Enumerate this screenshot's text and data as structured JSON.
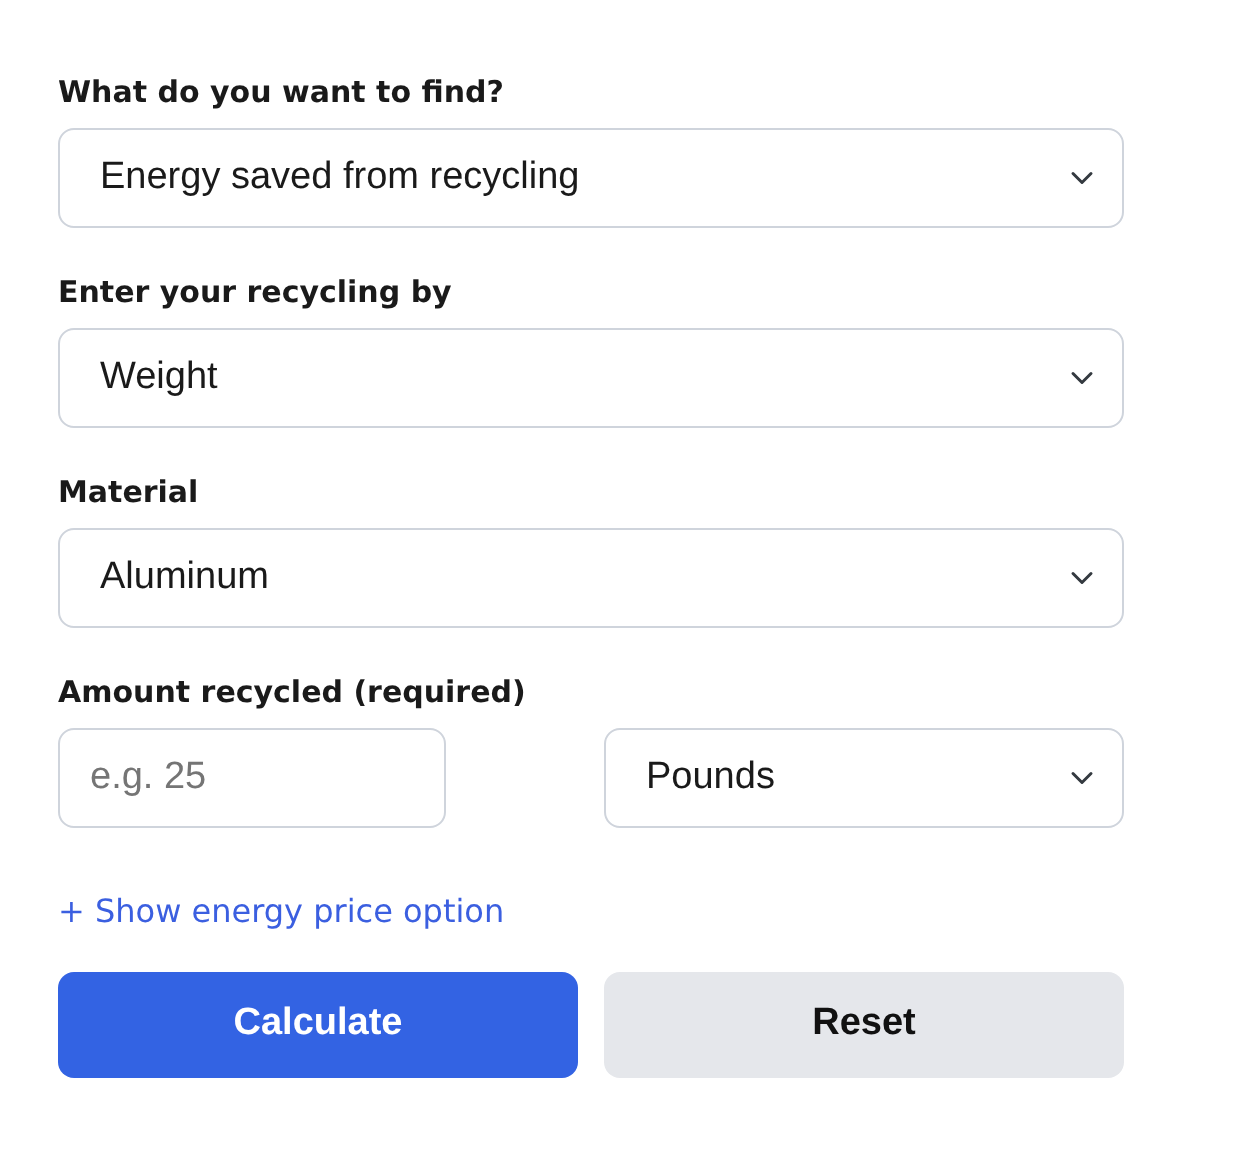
{
  "fields": [
    {
      "label": "What do you want to find?",
      "value": "Energy saved from recycling"
    },
    {
      "label": "Enter your recycling by",
      "value": "Weight"
    },
    {
      "label": "Material",
      "value": "Aluminum"
    }
  ],
  "amount": {
    "label": "Amount recycled (required)",
    "placeholder": "e.g. 25",
    "unit": "Pounds"
  },
  "toggle_link": "+ Show energy price option",
  "buttons": [
    {
      "label": "Calculate",
      "kind": "primary"
    },
    {
      "label": "Reset",
      "kind": "secondary"
    }
  ]
}
